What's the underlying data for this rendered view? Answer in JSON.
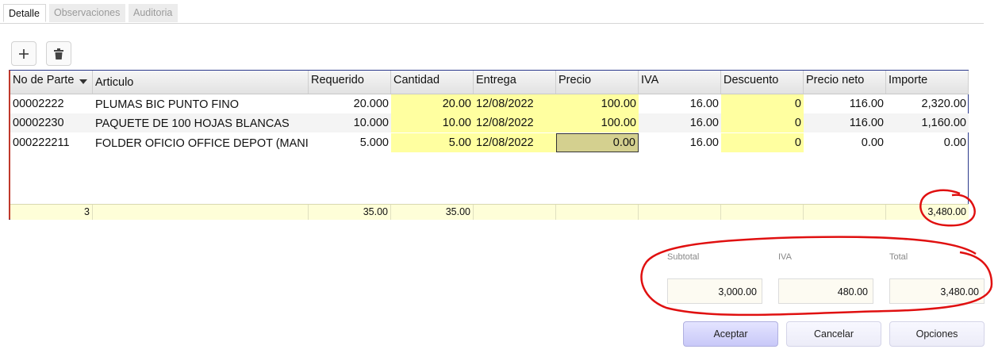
{
  "tabs": [
    {
      "label": "Detalle"
    },
    {
      "label": "Observaciones"
    },
    {
      "label": "Auditoria"
    }
  ],
  "toolbar": {
    "add_icon": "plus-icon",
    "delete_icon": "trash-icon"
  },
  "grid": {
    "columns": [
      "No de Parte",
      "Articulo",
      "Requerido",
      "Cantidad",
      "Entrega",
      "Precio",
      "IVA",
      "Descuento",
      "Precio neto",
      "Importe"
    ],
    "rows": [
      {
        "part": "00002222",
        "article": "PLUMAS BIC PUNTO FINO",
        "requerido": "20.000",
        "cantidad": "20.00",
        "entrega": "12/08/2022",
        "precio": "100.00",
        "iva": "16.00",
        "descuento": "0",
        "neto": "116.00",
        "importe": "2,320.00"
      },
      {
        "part": "00002230",
        "article": "PAQUETE DE 100 HOJAS BLANCAS",
        "requerido": "10.000",
        "cantidad": "10.00",
        "entrega": "12/08/2022",
        "precio": "100.00",
        "iva": "16.00",
        "descuento": "0",
        "neto": "116.00",
        "importe": "1,160.00"
      },
      {
        "part": "000222211",
        "article": "FOLDER OFICIO OFFICE DEPOT (MANI...",
        "requerido": "5.000",
        "cantidad": "5.00",
        "entrega": "12/08/2022",
        "precio": "0.00",
        "iva": "16.00",
        "descuento": "0",
        "neto": "0.00",
        "importe": "0.00"
      }
    ],
    "footer": {
      "count": "3",
      "requerido": "35.00",
      "cantidad": "35.00",
      "importe": "3,480.00"
    }
  },
  "totals": {
    "subtotal_label": "Subtotal",
    "subtotal": "3,000.00",
    "iva_label": "IVA",
    "iva": "480.00",
    "total_label": "Total",
    "total": "3,480.00"
  },
  "buttons": {
    "accept": "Aceptar",
    "cancel": "Cancelar",
    "options": "Opciones"
  },
  "colors": {
    "highlight_yellow": "#ffffa0",
    "annotation_red": "#e01010",
    "grid_border": "#2b3a8c"
  }
}
